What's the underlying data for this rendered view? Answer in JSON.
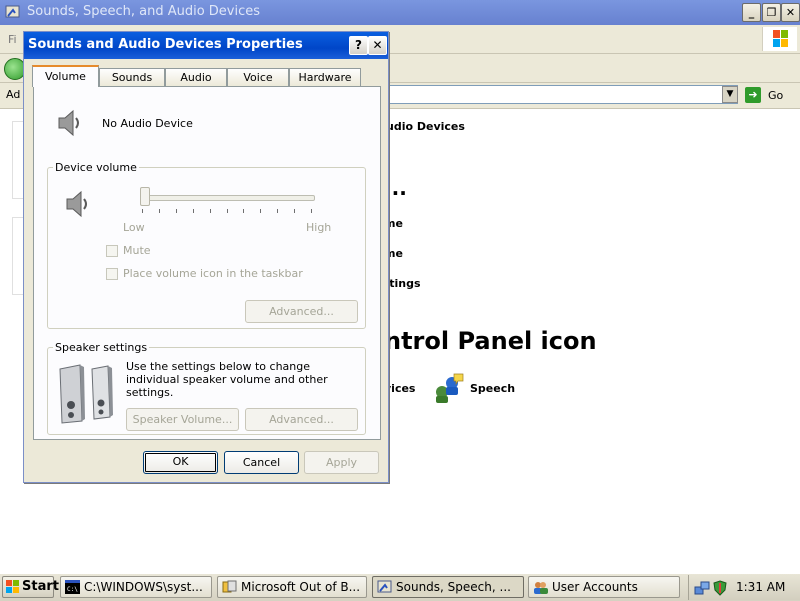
{
  "background_window": {
    "title": "Sounds, Speech, and Audio Devices",
    "menu_first": "Fi",
    "address_label": "Ad",
    "go_label": "Go",
    "content": {
      "crumb": "udio Devices",
      "heading_pick_task": "...",
      "task1": "me",
      "task2": "me",
      "task3": "ttings",
      "heading_pick_icon": "ntrol Panel icon",
      "cpl_item1": "vices",
      "cpl_item2": "Speech"
    }
  },
  "dialog": {
    "title": "Sounds and Audio Devices Properties",
    "help_label": "?",
    "close_label": "✕",
    "tabs": [
      {
        "label": "Volume",
        "active": true
      },
      {
        "label": "Sounds",
        "active": false
      },
      {
        "label": "Audio",
        "active": false
      },
      {
        "label": "Voice",
        "active": false
      },
      {
        "label": "Hardware",
        "active": false
      }
    ],
    "device_name": "No Audio Device",
    "device_volume": {
      "group_label": "Device volume",
      "low_label": "Low",
      "high_label": "High",
      "level": 0,
      "mute_label": "Mute",
      "mute_checked": false,
      "taskbar_label": "Place volume icon in the taskbar",
      "taskbar_checked": false,
      "advanced_label": "Advanced..."
    },
    "speaker_settings": {
      "group_label": "Speaker settings",
      "description": "Use the settings below to change individual speaker volume and other settings.",
      "speaker_volume_label": "Speaker Volume...",
      "advanced_label": "Advanced..."
    },
    "buttons": {
      "ok": "OK",
      "cancel": "Cancel",
      "apply": "Apply"
    }
  },
  "taskbar": {
    "start_label": "Start",
    "items": [
      {
        "label": "C:\\WINDOWS\\syst...",
        "icon": "cmd-icon"
      },
      {
        "label": "Microsoft Out of B...",
        "icon": "oobe-icon"
      },
      {
        "label": "Sounds, Speech, ...",
        "icon": "control-panel-icon",
        "active": true
      },
      {
        "label": "User Accounts",
        "icon": "users-icon"
      }
    ],
    "clock": "1:31 AM"
  },
  "colors": {
    "title_blue": "#0046c8",
    "dialog_face": "#ece9d8",
    "disabled_text": "#a5a597"
  }
}
